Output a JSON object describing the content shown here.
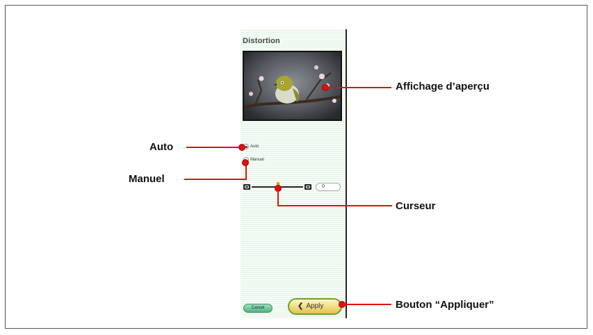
{
  "panel": {
    "title": "Distortion",
    "radio_auto": "Auto",
    "radio_manual": "Manual",
    "slider_value": "0",
    "cancel_label": "Cancel",
    "apply_label": "Apply",
    "selected_mode": "Auto"
  },
  "annotations": {
    "preview": "Affichage d’aperçu",
    "auto": "Auto",
    "manual": "Manuel",
    "slider": "Curseur",
    "apply": "Bouton “Appliquer”"
  },
  "colors": {
    "annotation_line": "#e01010",
    "panel_bg": "#eaf6ea",
    "apply_button": "#e2c34b",
    "cancel_button": "#4fb384"
  }
}
